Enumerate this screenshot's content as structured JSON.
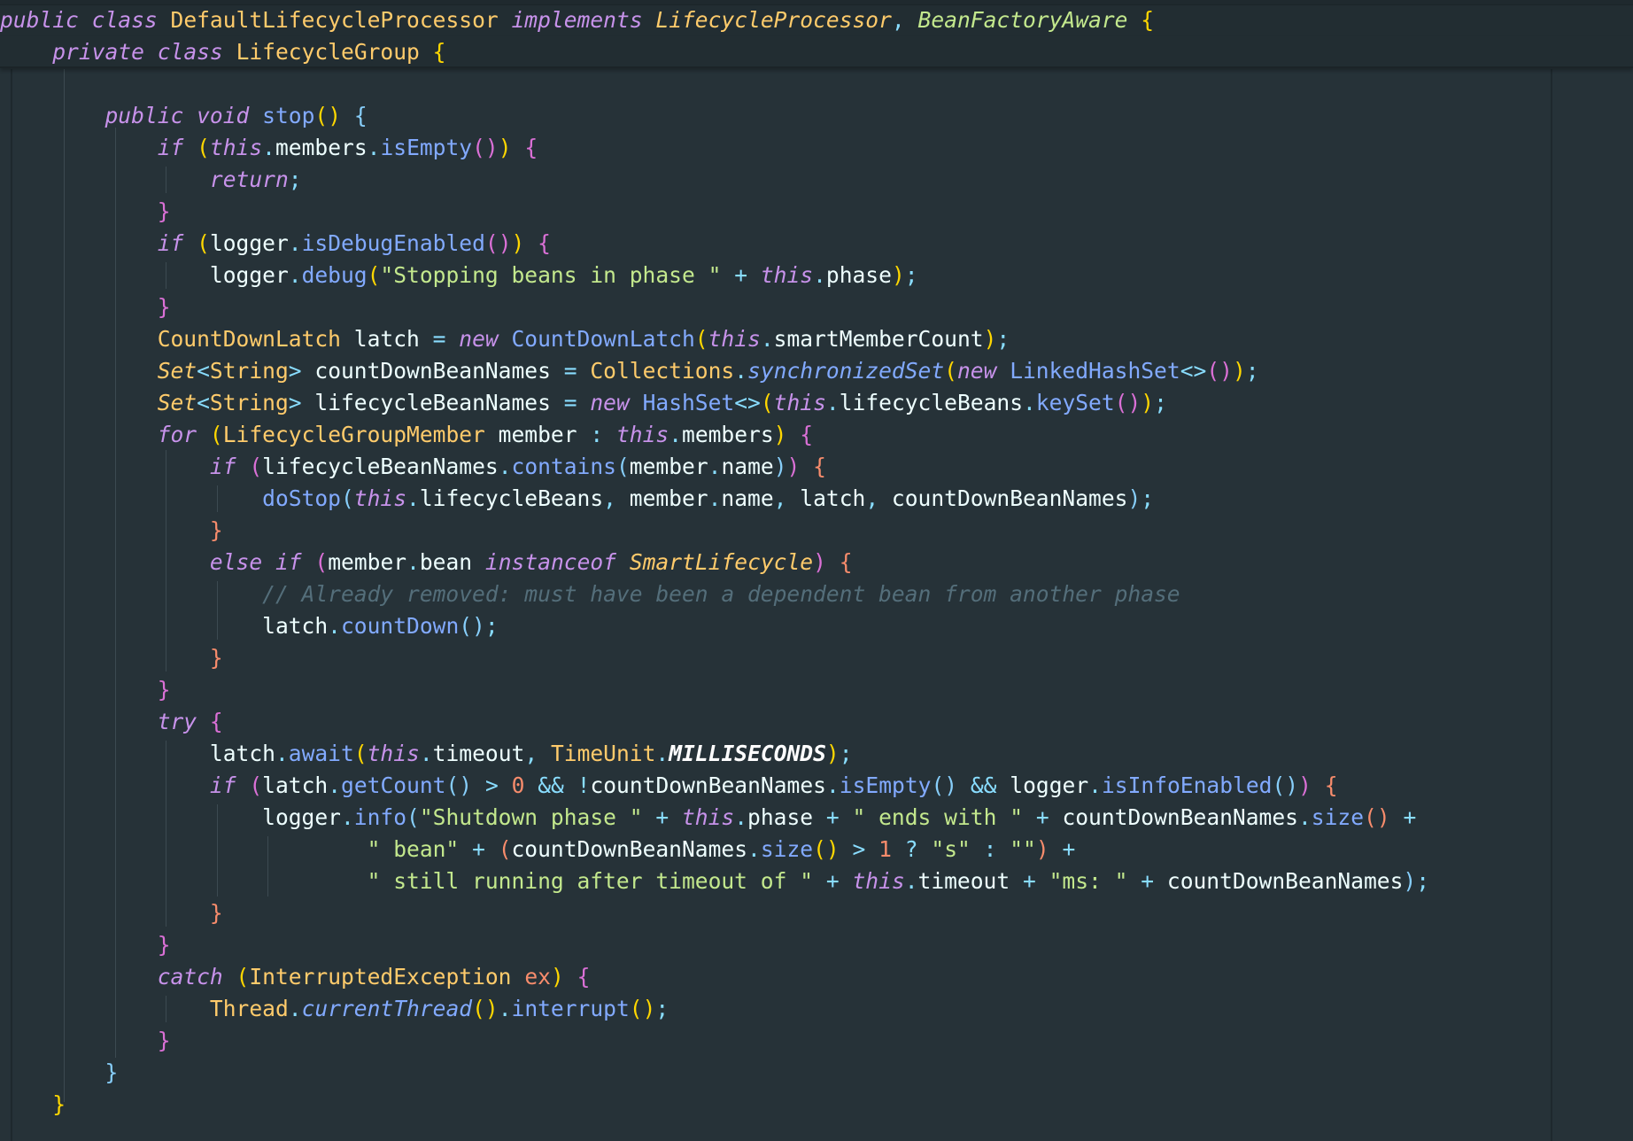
{
  "editor": {
    "language": "Java",
    "theme_colors": {
      "background": "#263238",
      "keyword": "#c792ea",
      "type": "#ffcb6b",
      "method": "#82aaff",
      "string": "#c3e88d",
      "comment": "#546e7a",
      "operator": "#89ddff"
    },
    "sticky_header": [
      "public class DefaultLifecycleProcessor implements LifecycleProcessor, BeanFactoryAware {",
      "    private class LifecycleGroup {"
    ],
    "code_lines": [
      "",
      "        public void stop() {",
      "            if (this.members.isEmpty()) {",
      "                return;",
      "            }",
      "            if (logger.isDebugEnabled()) {",
      "                logger.debug(\"Stopping beans in phase \" + this.phase);",
      "            }",
      "            CountDownLatch latch = new CountDownLatch(this.smartMemberCount);",
      "            Set<String> countDownBeanNames = Collections.synchronizedSet(new LinkedHashSet<>());",
      "            Set<String> lifecycleBeanNames = new HashSet<>(this.lifecycleBeans.keySet());",
      "            for (LifecycleGroupMember member : this.members) {",
      "                if (lifecycleBeanNames.contains(member.name)) {",
      "                    doStop(this.lifecycleBeans, member.name, latch, countDownBeanNames);",
      "                }",
      "                else if (member.bean instanceof SmartLifecycle) {",
      "                    // Already removed: must have been a dependent bean from another phase",
      "                    latch.countDown();",
      "                }",
      "            }",
      "            try {",
      "                latch.await(this.timeout, TimeUnit.MILLISECONDS);",
      "                if (latch.getCount() > 0 && !countDownBeanNames.isEmpty() && logger.isInfoEnabled()) {",
      "                    logger.info(\"Shutdown phase \" + this.phase + \" ends with \" + countDownBeanNames.size() +",
      "                            \" bean\" + (countDownBeanNames.size() > 1 ? \"s\" : \"\") +",
      "                            \" still running after timeout of \" + this.timeout + \"ms: \" + countDownBeanNames);",
      "                }",
      "            }",
      "            catch (InterruptedException ex) {",
      "                Thread.currentThread().interrupt();",
      "            }",
      "        }",
      "    }"
    ]
  }
}
